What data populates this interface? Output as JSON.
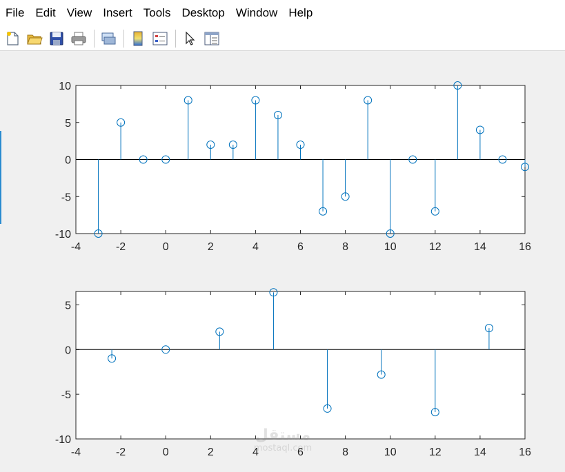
{
  "menu": [
    "File",
    "Edit",
    "View",
    "Insert",
    "Tools",
    "Desktop",
    "Window",
    "Help"
  ],
  "toolbar": {
    "buttons": [
      {
        "icon": "new-figure-icon"
      },
      {
        "icon": "open-file-icon"
      },
      {
        "icon": "save-icon"
      },
      {
        "icon": "print-icon"
      },
      {
        "icon": "link-figure-icon"
      },
      {
        "icon": "insert-colorbar-icon"
      },
      {
        "icon": "insert-legend-icon"
      },
      {
        "icon": "edit-plot-arrow-icon"
      },
      {
        "icon": "property-inspector-icon"
      }
    ]
  },
  "colors": {
    "stem": "#0072bd",
    "background": "#f0f0f0",
    "axes_bg": "#ffffff"
  },
  "watermark": {
    "arabic": "مستقل",
    "latin": "mostaql.com"
  },
  "chart_data": [
    {
      "type": "stem",
      "x": [
        -3,
        -2,
        -1,
        0,
        1,
        2,
        3,
        4,
        5,
        6,
        7,
        8,
        9,
        10,
        11,
        12,
        13,
        14,
        15,
        16
      ],
      "y": [
        -10,
        5,
        0,
        0,
        8,
        2,
        2,
        8,
        6,
        2,
        -7,
        -5,
        8,
        -10,
        0,
        -7,
        10,
        4,
        0,
        -1
      ],
      "xlim": [
        -4,
        16
      ],
      "ylim": [
        -10,
        10
      ],
      "xticks": [
        -4,
        -2,
        0,
        2,
        4,
        6,
        8,
        10,
        12,
        14,
        16
      ],
      "yticks": [
        -10,
        -5,
        0,
        5,
        10
      ],
      "xticklabels": [
        "-4",
        "-2",
        "0",
        "2",
        "4",
        "6",
        "8",
        "10",
        "12",
        "14",
        "16"
      ],
      "yticklabels": [
        "-10",
        "-5",
        "0",
        "5",
        "10"
      ],
      "grid": false
    },
    {
      "type": "stem",
      "x": [
        -2.4,
        0,
        2.4,
        4.8,
        7.2,
        9.6,
        12,
        14.4
      ],
      "y": [
        -1,
        0,
        2,
        6.4,
        -6.6,
        -2.8,
        -7,
        2.4
      ],
      "xlim": [
        -4,
        16
      ],
      "ylim": [
        -10,
        6.5
      ],
      "xticks": [
        -4,
        -2,
        0,
        2,
        4,
        6,
        8,
        10,
        12,
        14,
        16
      ],
      "yticks": [
        -10,
        -5,
        0,
        5
      ],
      "xticklabels": [
        "-4",
        "-2",
        "0",
        "2",
        "4",
        "6",
        "8",
        "10",
        "12",
        "14",
        "16"
      ],
      "yticklabels": [
        "-10",
        "-5",
        "0",
        "5"
      ],
      "grid": false
    }
  ]
}
